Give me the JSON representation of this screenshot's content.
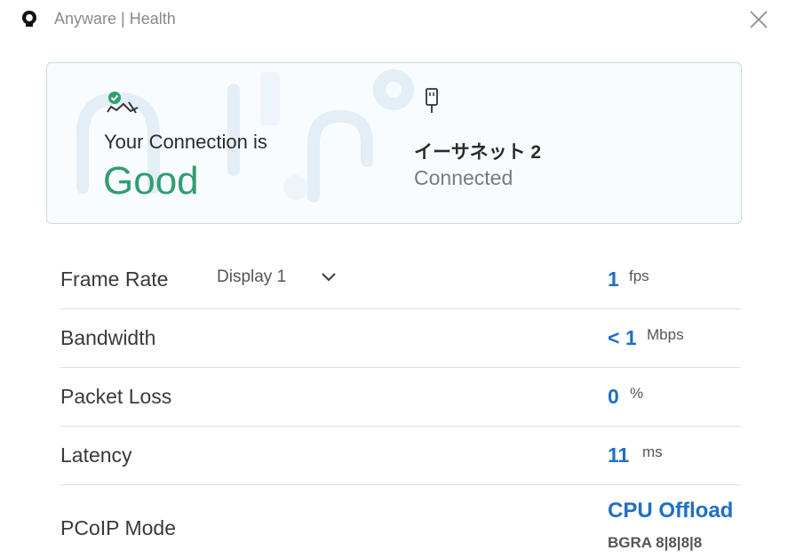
{
  "app": {
    "title": "Anyware | Health"
  },
  "connection": {
    "label": "Your Connection is",
    "status": "Good",
    "status_color": "#2f9e6e",
    "network_name": "イーサネット 2",
    "network_status": "Connected"
  },
  "metrics": {
    "frame_rate": {
      "label": "Frame Rate",
      "display_selector": "Display 1",
      "value": "1",
      "unit": "fps"
    },
    "bandwidth": {
      "label": "Bandwidth",
      "value": "< 1",
      "unit": "Mbps"
    },
    "packet_loss": {
      "label": "Packet Loss",
      "value": "0",
      "unit": "%"
    },
    "latency": {
      "label": "Latency",
      "value": "11",
      "unit": "ms"
    },
    "pcoip_mode": {
      "label": "PCoIP Mode",
      "value": "CPU Offload",
      "detail": "BGRA 8|8|8|8"
    }
  },
  "colors": {
    "accent_blue": "#1f6fc4",
    "good_green": "#2f9e6e"
  },
  "icons": [
    "app-logo-icon",
    "close-icon",
    "connection-good-icon",
    "ethernet-icon",
    "chevron-down-icon"
  ]
}
